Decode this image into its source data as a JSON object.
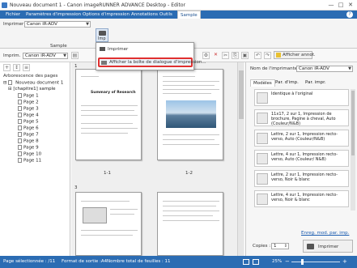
{
  "window": {
    "title": "Nouveau document 1 - Canon imageRUNNER ADVANCE Desktop - Editor",
    "min": "—",
    "max": "□",
    "close": "✕"
  },
  "menu": [
    "Fichier",
    "Paramètres d'impression",
    "Options d'impression",
    "Annotations",
    "Outils",
    "Sample"
  ],
  "ribbon": {
    "printer_label": "Imprimer :",
    "printer_value": "Canon iR-ADV",
    "print_button_label": "Imp",
    "group_label": "Sample",
    "help_icon": "?"
  },
  "popup": {
    "print": "Imprimer",
    "dialog": "Afficher la boîte de dialogue d'impression..."
  },
  "secondary": {
    "printer_label": "Imprim.",
    "printer_value": "Canon iR-ADV",
    "show_annot": "Afficher annot."
  },
  "tree": {
    "title": "Arborescence des pages",
    "root": "Nouveau document 1",
    "chapter": "[chapitre1] sample",
    "pages": [
      "Page 1",
      "Page 2",
      "Page 3",
      "Page 4",
      "Page 5",
      "Page 6",
      "Page 7",
      "Page 8",
      "Page 9",
      "Page 10",
      "Page 11"
    ]
  },
  "pages": {
    "p1_title": "Summary of Research",
    "p1_num": "1",
    "p1_label": "1-1",
    "p2_label": "1-2",
    "p3_num": "3"
  },
  "right": {
    "printer_name_label": "Nom de l'imprimante :",
    "printer_name_value": "Canon iR-ADV",
    "tabs": [
      "Modèles",
      "Par. d'imp.",
      "Par. impr."
    ],
    "favorites": [
      "Identique à l'original",
      "11x17, 2 sur 1, Impression de brochure, Pagine à cheval, Auto (Couleur/N&B)",
      "Lettre, 2 sur 1, Impression recto-verso, Auto (Couleur/N&B)",
      "Lettre, 4 sur 1, Impression recto-verso, Auto (Couleur/ N&B)",
      "Lettre, 2 sur 1, Impression recto-verso, Noir & blanc",
      "Lettre, 4 sur 1, Impression recto-verso, Noir & blanc"
    ],
    "link": "Enreg. mod. par. imp.",
    "copies_label": "Copies :",
    "copies_value": "1",
    "print_btn": "Imprimer"
  },
  "status": {
    "selected": "Page sélectionnée : /11",
    "format": "Format de sortie :A4",
    "sheets": "Nombre total de feuilles : 11",
    "zoom": "25%"
  },
  "colors": {
    "menubar": "#2b6cb3",
    "highlight": "#e03030"
  }
}
